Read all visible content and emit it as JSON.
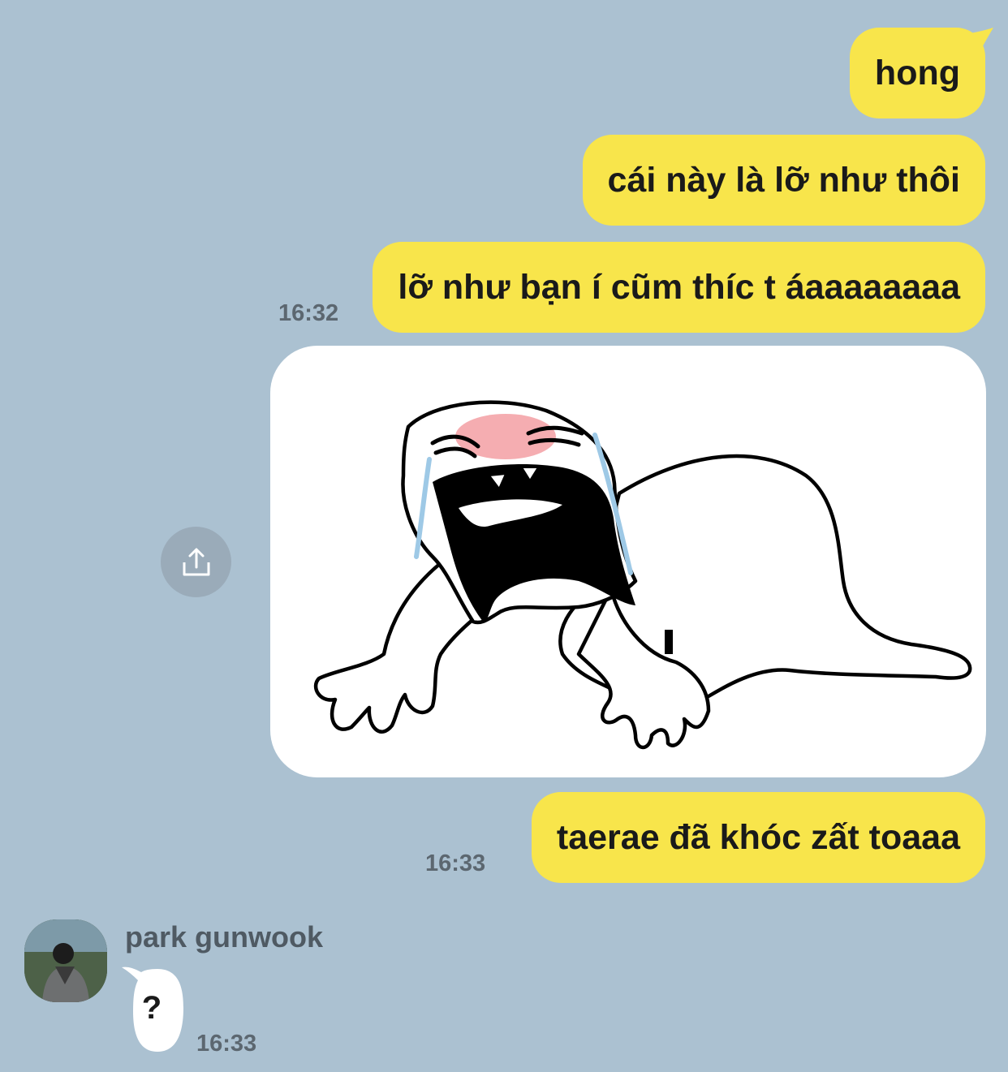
{
  "chat": {
    "messages_out": [
      {
        "text": "hong"
      },
      {
        "text": "cái này là lỡ như thôi"
      },
      {
        "text": "lỡ như bạn í cũm thíc t áaaaaaaaa",
        "time": "16:32"
      },
      {
        "text": "taerae đã khóc zất toaaa",
        "time": "16:33"
      }
    ],
    "sticker": {
      "icon": "crying-creature-sticker"
    },
    "share_button": {
      "icon": "share-icon"
    },
    "incoming": {
      "sender": "park gunwook",
      "text": "?",
      "time": "16:33"
    }
  },
  "colors": {
    "background": "#abc1d1",
    "outgoing_bubble": "#f8e54b",
    "incoming_bubble": "#ffffff",
    "timestamp": "#5c6770"
  }
}
